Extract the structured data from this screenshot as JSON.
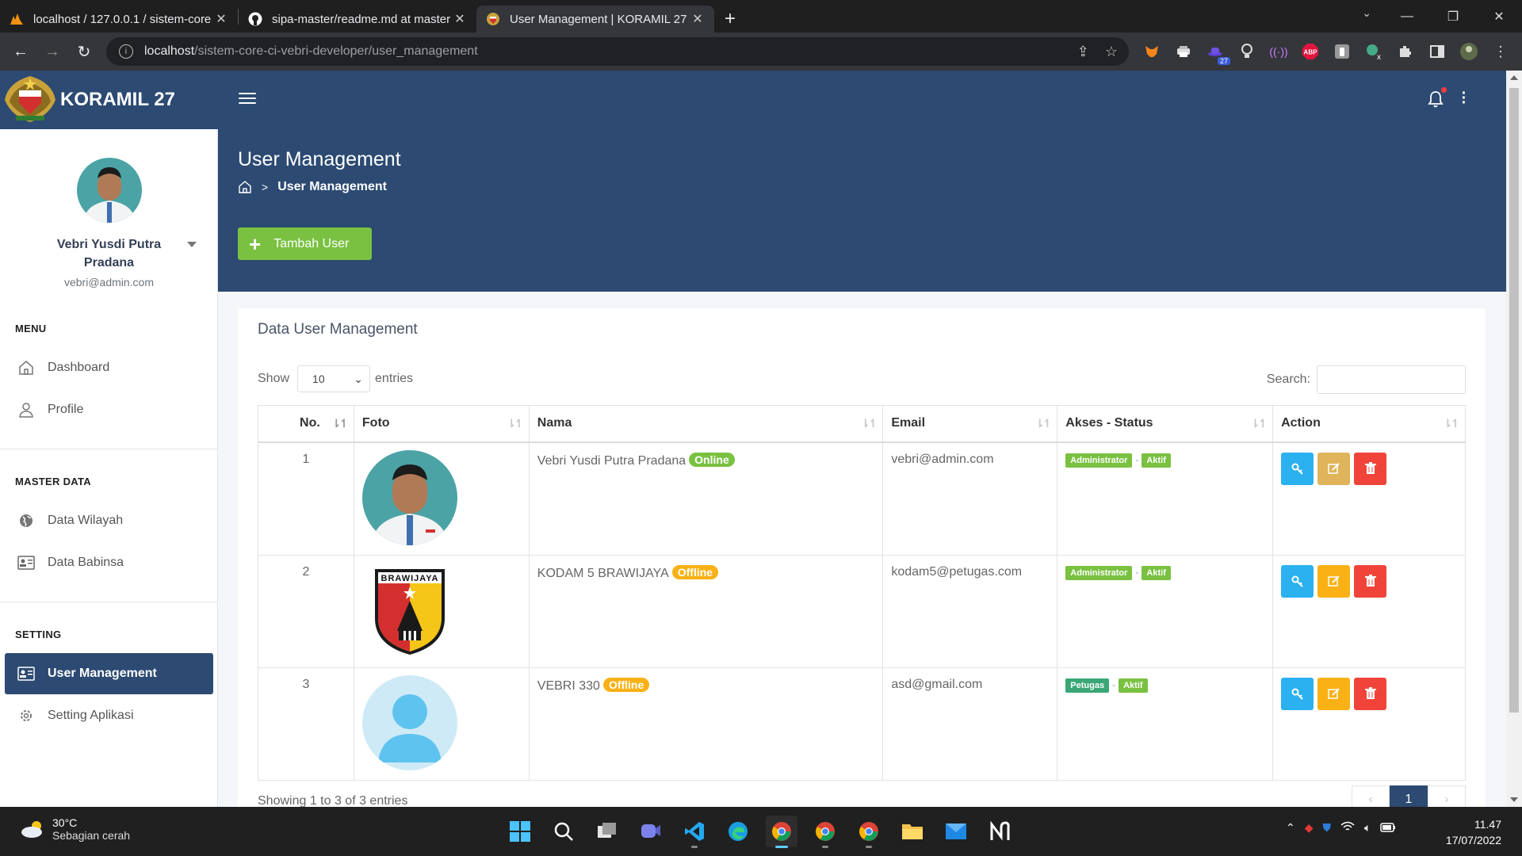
{
  "browser": {
    "tabs": [
      {
        "title": "localhost / 127.0.0.1 / sistem-core",
        "active": false,
        "icon": "phpmyadmin-icon"
      },
      {
        "title": "sipa-master/readme.md at master",
        "active": false,
        "icon": "github-icon"
      },
      {
        "title": "User Management | KORAMIL 27",
        "active": true,
        "icon": "koramil-logo-icon"
      }
    ],
    "url_host": "localhost",
    "url_path": "/sistem-core-ci-vebri-developer/user_management",
    "ext_badge": "27",
    "ext_abp": "ABP"
  },
  "app": {
    "brand_name": "KORAMIL 27",
    "user": {
      "name": "Vebri Yusdi Putra Pradana",
      "email": "vebri@admin.com"
    },
    "sidebar": {
      "sections": [
        {
          "title": "MENU",
          "items": [
            {
              "label": "Dashboard",
              "icon": "home-icon"
            },
            {
              "label": "Profile",
              "icon": "user-icon"
            }
          ]
        },
        {
          "title": "MASTER DATA",
          "items": [
            {
              "label": "Data Wilayah",
              "icon": "globe-icon"
            },
            {
              "label": "Data Babinsa",
              "icon": "id-card-icon"
            }
          ]
        },
        {
          "title": "SETTING",
          "items": [
            {
              "label": "User Management",
              "icon": "id-card-icon",
              "active": true
            },
            {
              "label": "Setting Aplikasi",
              "icon": "gear-icon"
            }
          ]
        }
      ]
    }
  },
  "page": {
    "title": "User Management",
    "breadcrumb_current": "User Management",
    "add_button_label": "Tambah User"
  },
  "table": {
    "card_title": "Data User Management",
    "show_label": "Show",
    "entries_value": "10",
    "entries_label": "entries",
    "search_label": "Search:",
    "columns": [
      "No.",
      "Foto",
      "Nama",
      "Email",
      "Akses - Status",
      "Action"
    ],
    "rows": [
      {
        "no": "1",
        "nama": "Vebri Yusdi Putra Pradana",
        "status": "Online",
        "email": "vebri@admin.com",
        "akses": "Administrator",
        "aktif": "Aktif",
        "foto": "person-photo"
      },
      {
        "no": "2",
        "nama": "KODAM 5 BRAWIJAYA",
        "status": "Offline",
        "email": "kodam5@petugas.com",
        "akses": "Administrator",
        "aktif": "Aktif",
        "foto": "brawijaya-emblem"
      },
      {
        "no": "3",
        "nama": "VEBRI 330",
        "status": "Offline",
        "email": "asd@gmail.com",
        "akses": "Petugas",
        "aktif": "Aktif",
        "foto": "default-avatar"
      }
    ],
    "emblem_text": "BRAWIJAYA",
    "footer_info": "Showing 1 to 3 of 3 entries",
    "pagination": {
      "prev": "‹",
      "current": "1",
      "next": "›"
    }
  },
  "taskbar": {
    "temperature": "30°C",
    "weather": "Sebagian cerah",
    "time": "11.47",
    "date": "17/07/2022"
  },
  "colors": {
    "primary": "#2c4a72",
    "success": "#7ac142",
    "warning": "#f9b115",
    "danger": "#f0443a",
    "info": "#2bb0f0"
  }
}
